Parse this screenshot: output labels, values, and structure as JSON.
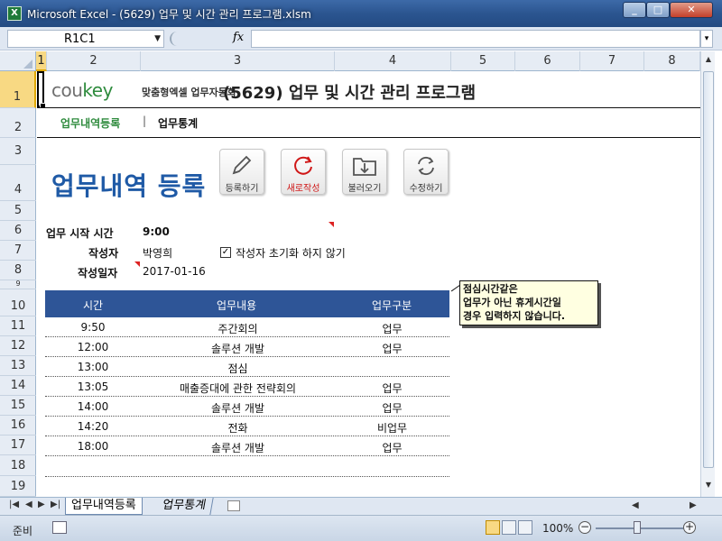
{
  "window": {
    "title": "Microsoft Excel - (5629) 업무 및 시간 관리 프로그램.xlsm",
    "app_icon": "X",
    "min": "_",
    "max": "□",
    "close": "✕"
  },
  "formula_bar": {
    "name_box": "R1C1",
    "fx": "fx",
    "content": ""
  },
  "columns": [
    "1",
    "2",
    "3",
    "4",
    "5",
    "6",
    "7",
    "8"
  ],
  "rows": [
    "1",
    "2",
    "3",
    "4",
    "5",
    "6",
    "7",
    "8",
    "9",
    "10",
    "11",
    "12",
    "13",
    "14",
    "15",
    "16",
    "17",
    "18",
    "19"
  ],
  "header": {
    "logo_main": "cou",
    "logo_key": "key",
    "logo_sub": "맞춤형엑셀 업무자동화",
    "title": "(5629) 업무 및 시간 관리 프로그램"
  },
  "nav": {
    "register": "업무내역등록",
    "sep": "|",
    "stats": "업무통계"
  },
  "page_title": "업무내역 등록",
  "toolbar": {
    "register": "등록하기",
    "new": "새로작성",
    "load": "불러오기",
    "edit": "수정하기"
  },
  "form": {
    "start_label": "업무 시작 시간",
    "start_value": "9:00",
    "author_label": "작성자",
    "author_value": "박영희",
    "keep_author_label": "작성자 초기화 하지 않기",
    "keep_author_checked": "✓",
    "date_label": "작성일자",
    "date_value": "2017-01-16"
  },
  "table": {
    "headers": {
      "time": "시간",
      "content": "업무내용",
      "category": "업무구분"
    },
    "rows": [
      {
        "time": "9:50",
        "content": "주간회의",
        "category": "업무"
      },
      {
        "time": "12:00",
        "content": "솔루션 개발",
        "category": "업무"
      },
      {
        "time": "13:00",
        "content": "점심",
        "category": ""
      },
      {
        "time": "13:05",
        "content": "매출증대에 관한 전략회의",
        "category": "업무"
      },
      {
        "time": "14:00",
        "content": "솔루션 개발",
        "category": "업무"
      },
      {
        "time": "14:20",
        "content": "전화",
        "category": "비업무"
      },
      {
        "time": "18:00",
        "content": "솔루션 개발",
        "category": "업무"
      },
      {
        "time": "",
        "content": "",
        "category": ""
      },
      {
        "time": "",
        "content": "",
        "category": ""
      }
    ]
  },
  "comment": {
    "line1": "점심시간같은",
    "line2": "업무가 아닌 휴게시간일",
    "line3": "경우 입력하지 않습니다."
  },
  "sheet_tabs": {
    "tab1": "업무내역등록",
    "tab2": "업무통계"
  },
  "status": {
    "ready": "준비",
    "zoom": "100%",
    "minus": "−",
    "plus": "+"
  },
  "colors": {
    "accent_blue": "#1f5aa6",
    "table_header": "#2e5597",
    "brand_green": "#2e8b3d",
    "alert_red": "#d01818"
  }
}
